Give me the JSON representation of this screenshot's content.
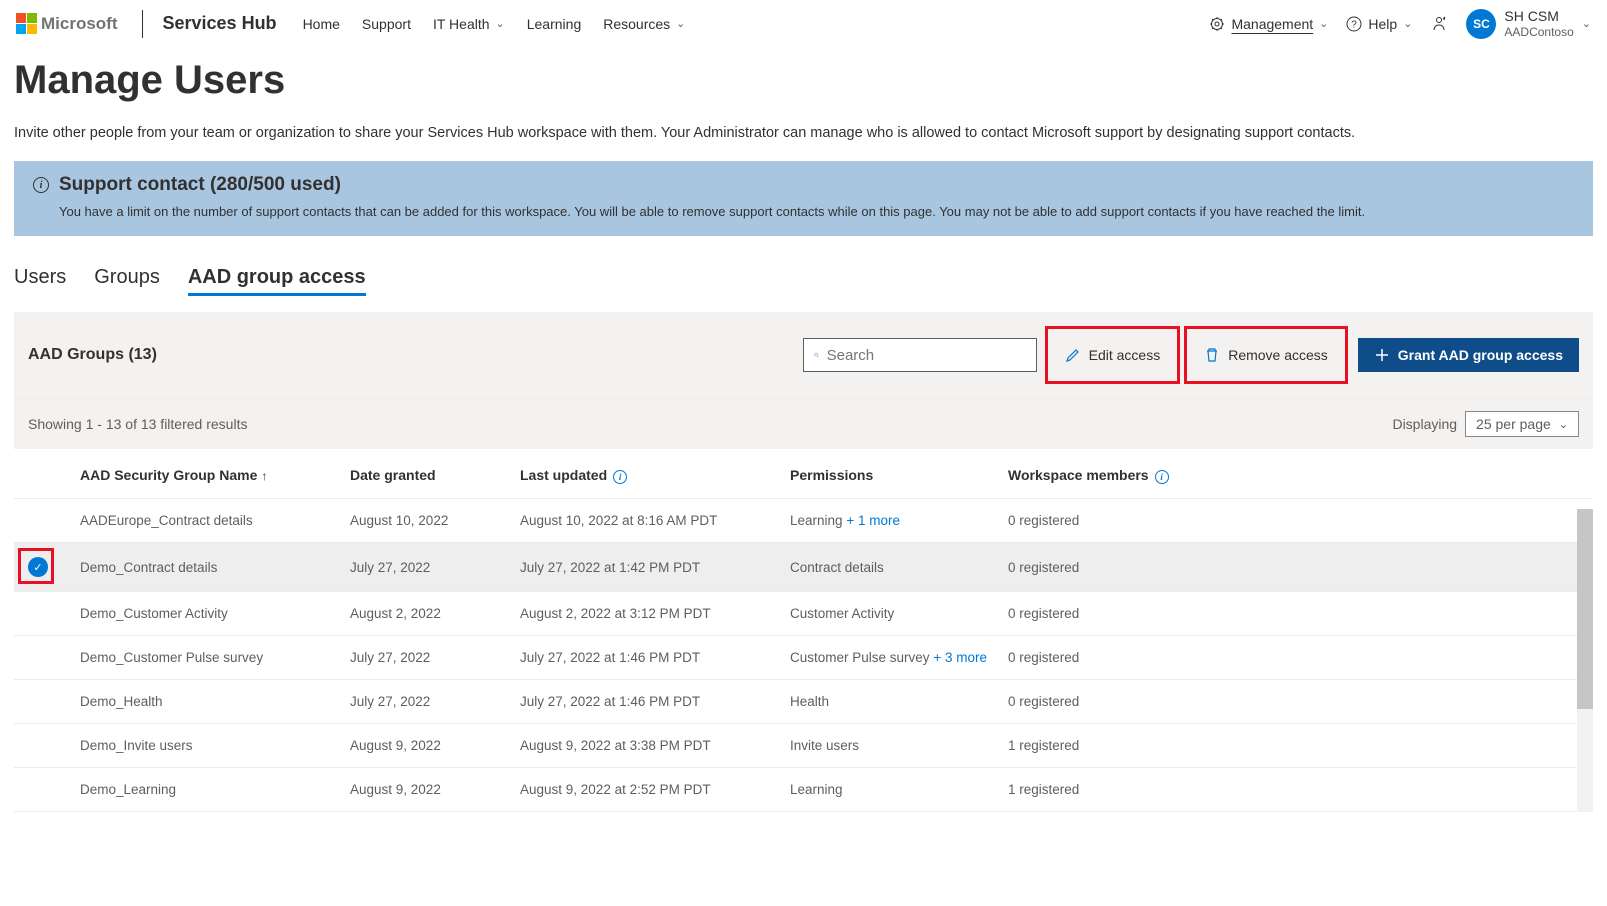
{
  "header": {
    "ms": "Microsoft",
    "brand": "Services Hub",
    "nav": [
      "Home",
      "Support",
      "IT Health",
      "Learning",
      "Resources"
    ],
    "management": "Management",
    "help": "Help",
    "account": {
      "initials": "SC",
      "name": "SH CSM",
      "org": "AADContoso"
    }
  },
  "page": {
    "title": "Manage Users",
    "intro": "Invite other people from your team or organization to share your Services Hub workspace with them. Your Administrator can manage who is allowed to contact Microsoft support by designating support contacts."
  },
  "banner": {
    "title": "Support contact (280/500 used)",
    "body": "You have a limit on the number of support contacts that can be added for this workspace. You will be able to remove support contacts while on this page. You may not be able to add support contacts if you have reached the limit."
  },
  "tabs": [
    "Users",
    "Groups",
    "AAD group access"
  ],
  "toolbar": {
    "title": "AAD Groups (13)",
    "search_placeholder": "Search",
    "edit": "Edit access",
    "remove": "Remove access",
    "grant": "Grant AAD group access"
  },
  "results": {
    "showing": "Showing 1 - 13 of 13 filtered results",
    "displaying": "Displaying",
    "per_page": "25 per page"
  },
  "columns": {
    "name": "AAD Security Group Name",
    "date": "Date granted",
    "updated": "Last updated",
    "perm": "Permissions",
    "members": "Workspace members"
  },
  "rows": [
    {
      "name": "AADEurope_Contract details",
      "date": "August 10, 2022",
      "updated": "August 10, 2022 at 8:16 AM PDT",
      "perm": "Learning",
      "more": "+ 1 more",
      "members": "0 registered",
      "selected": false
    },
    {
      "name": "Demo_Contract details",
      "date": "July 27, 2022",
      "updated": "July 27, 2022 at 1:42 PM PDT",
      "perm": "Contract details",
      "more": "",
      "members": "0 registered",
      "selected": true
    },
    {
      "name": "Demo_Customer Activity",
      "date": "August 2, 2022",
      "updated": "August 2, 2022 at 3:12 PM PDT",
      "perm": "Customer Activity",
      "more": "",
      "members": "0 registered",
      "selected": false
    },
    {
      "name": "Demo_Customer Pulse survey",
      "date": "July 27, 2022",
      "updated": "July 27, 2022 at 1:46 PM PDT",
      "perm": "Customer Pulse survey",
      "more": "+ 3 more",
      "members": "0 registered",
      "selected": false
    },
    {
      "name": "Demo_Health",
      "date": "July 27, 2022",
      "updated": "July 27, 2022 at 1:46 PM PDT",
      "perm": "Health",
      "more": "",
      "members": "0 registered",
      "selected": false
    },
    {
      "name": "Demo_Invite users",
      "date": "August 9, 2022",
      "updated": "August 9, 2022 at 3:38 PM PDT",
      "perm": "Invite users",
      "more": "",
      "members": "1 registered",
      "selected": false
    },
    {
      "name": "Demo_Learning",
      "date": "August 9, 2022",
      "updated": "August 9, 2022 at 2:52 PM PDT",
      "perm": "Learning",
      "more": "",
      "members": "1 registered",
      "selected": false
    }
  ]
}
